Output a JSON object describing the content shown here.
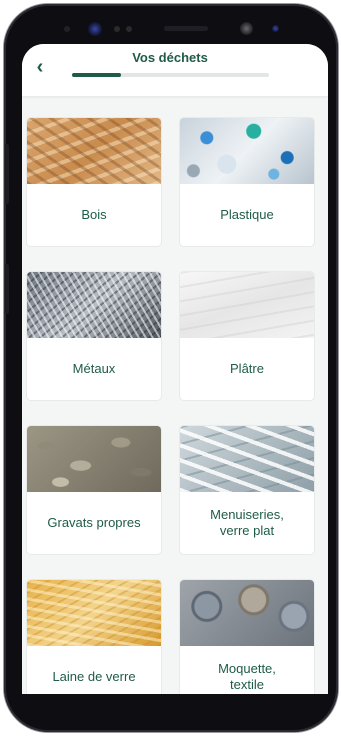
{
  "header": {
    "title": "Vos déchets",
    "back_icon": "chevron-left-icon",
    "progress": 0.25
  },
  "colors": {
    "accent": "#1f5c46",
    "background": "#f4f6f6"
  },
  "categories": [
    {
      "label": "Bois",
      "image": "wood-chips-image"
    },
    {
      "label": "Plastique",
      "image": "plastic-flakes-image"
    },
    {
      "label": "Métaux",
      "image": "metal-shavings-image"
    },
    {
      "label": "Plâtre",
      "image": "plaster-image"
    },
    {
      "label": "Gravats propres",
      "image": "gravel-image"
    },
    {
      "label": "Menuiseries, verre plat",
      "image": "window-frames-image"
    },
    {
      "label": "Laine de verre",
      "image": "glass-wool-image"
    },
    {
      "label": "Moquette, textile",
      "image": "carpet-rolls-image"
    }
  ]
}
